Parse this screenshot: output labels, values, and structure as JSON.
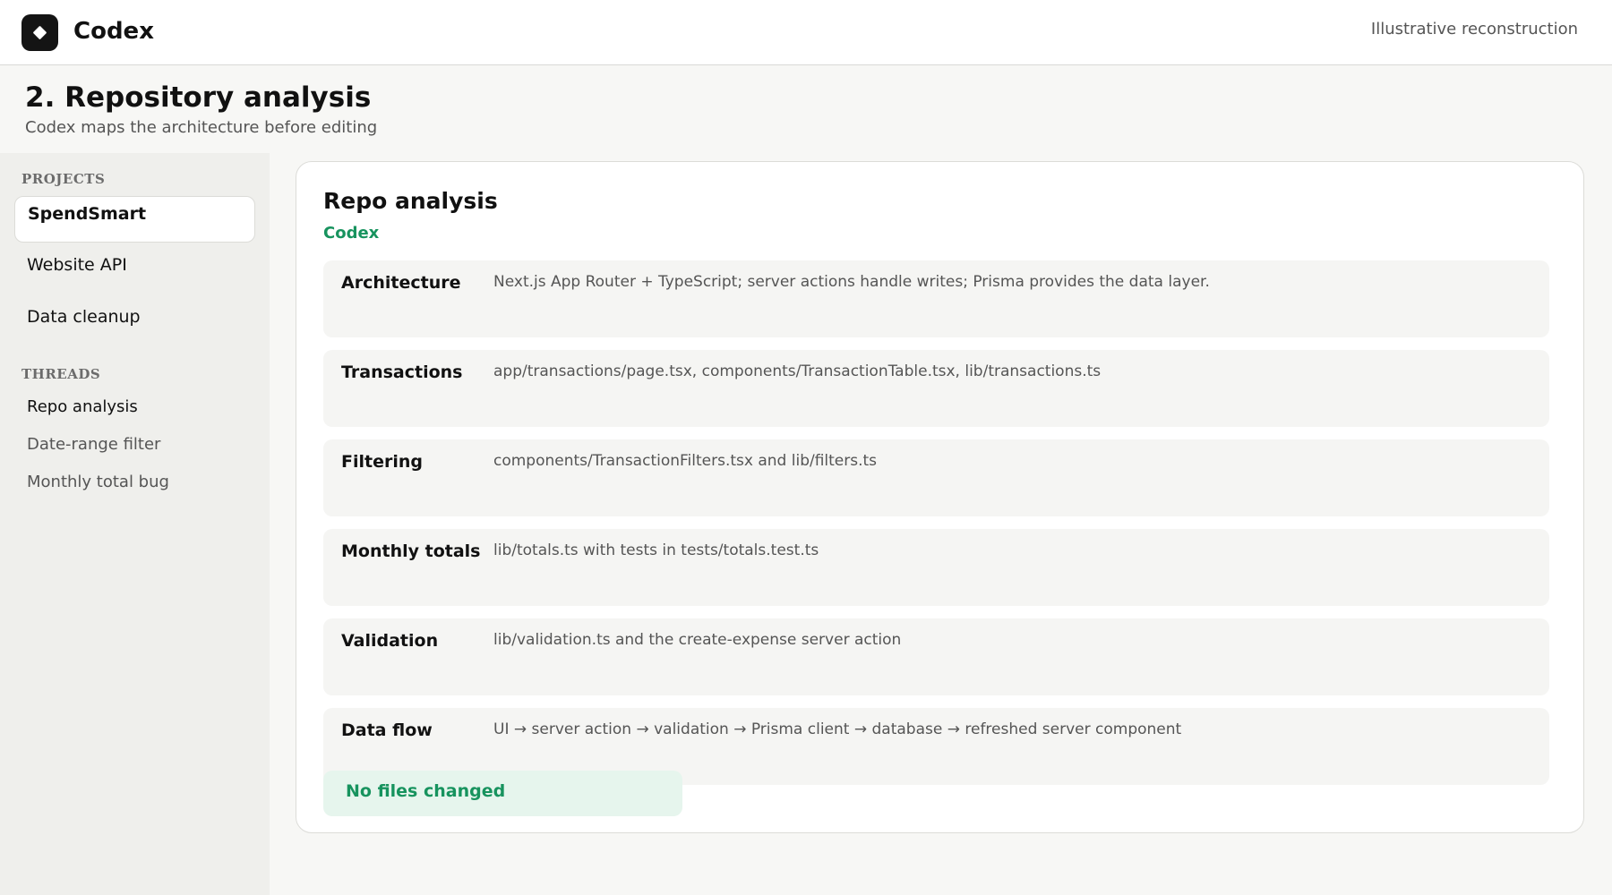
{
  "app": {
    "title": "Codex",
    "note": "Illustrative reconstruction"
  },
  "page": {
    "title": "2. Repository analysis",
    "subtitle": "Codex maps the architecture before editing"
  },
  "sidebar": {
    "projects_label": "PROJECTS",
    "projects": [
      {
        "label": "SpendSmart",
        "active": true
      },
      {
        "label": "Website API",
        "active": false
      },
      {
        "label": "Data cleanup",
        "active": false
      }
    ],
    "threads_label": "THREADS",
    "threads": [
      {
        "label": "Repo analysis",
        "active": true
      },
      {
        "label": "Date-range filter",
        "active": false
      },
      {
        "label": "Monthly total bug",
        "active": false
      }
    ]
  },
  "card": {
    "title": "Repo analysis",
    "author": "Codex",
    "rows": [
      {
        "key": "Architecture",
        "value": "Next.js App Router + TypeScript; server actions handle writes; Prisma provides the data layer."
      },
      {
        "key": "Transactions",
        "value": "app/transactions/page.tsx, components/TransactionTable.tsx, lib/transactions.ts"
      },
      {
        "key": "Filtering",
        "value": "components/TransactionFilters.tsx and lib/filters.ts"
      },
      {
        "key": "Monthly totals",
        "value": "lib/totals.ts with tests in tests/totals.test.ts"
      },
      {
        "key": "Validation",
        "value": "lib/validation.ts and the create-expense server action"
      },
      {
        "key": "Data flow",
        "value": "UI → server action → validation → Prisma client → database → refreshed server component"
      }
    ],
    "status": "No files changed"
  },
  "colors": {
    "accent": "#17935e",
    "status_bg": "#e6f5ed",
    "logo_bg": "#141414"
  },
  "icons": {
    "logo": "diamond-logo-icon"
  }
}
